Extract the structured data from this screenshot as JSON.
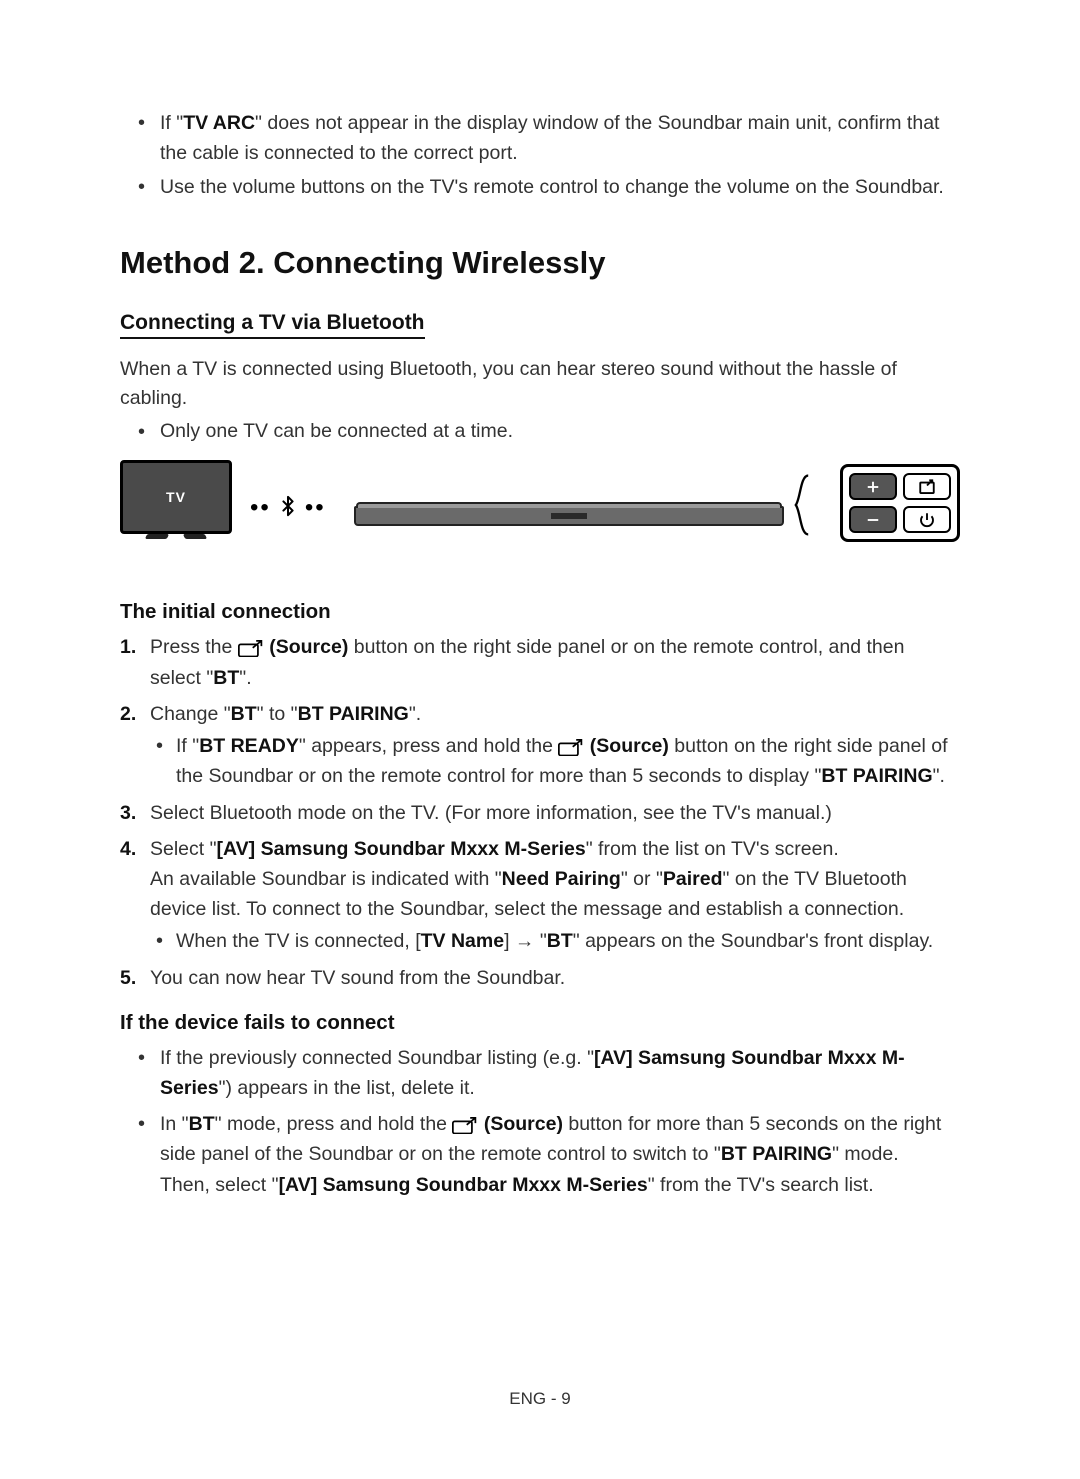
{
  "top_bullets": {
    "b1_pre": "If \"",
    "b1_bold": "TV ARC",
    "b1_post": "\" does not appear in the display window of the Soundbar main unit, confirm that the cable is connected to the correct port.",
    "b2": "Use the volume buttons on the TV's remote control to change the volume on the Soundbar."
  },
  "method_title": "Method 2. Connecting Wirelessly",
  "sub_title": "Connecting a TV via Bluetooth",
  "intro_text": "When a TV is connected using Bluetooth, you can hear stereo sound without the hassle of cabling.",
  "intro_bullet": "Only one TV can be connected at a time.",
  "diagram": {
    "tv_label": "TV"
  },
  "initial_heading": "The initial connection",
  "steps": {
    "s1_a": "Press the ",
    "s1_source": " (Source)",
    "s1_b": " button on the right side panel or on the remote control, and then select \"",
    "s1_bt": "BT",
    "s1_c": "\".",
    "s2_a": "Change \"",
    "s2_bt": "BT",
    "s2_b": "\" to \"",
    "s2_pair": "BT PAIRING",
    "s2_c": "\".",
    "s2_bullet_a": "If \"",
    "s2_bullet_btready": "BT READY",
    "s2_bullet_b": "\" appears, press and hold the ",
    "s2_bullet_source": " (Source)",
    "s2_bullet_c": " button on the right side panel of the Soundbar or on the remote control for more than 5 seconds to display \"",
    "s2_bullet_pair": "BT PAIRING",
    "s2_bullet_d": "\".",
    "s3": "Select Bluetooth mode on the TV. (For more information, see the TV's manual.)",
    "s4_a": "Select \"",
    "s4_av": "[AV] Samsung Soundbar Mxxx M-Series",
    "s4_b": "\" from the list on TV's screen.",
    "s4_c": "An available Soundbar is indicated with \"",
    "s4_need": "Need Pairing",
    "s4_d": "\" or \"",
    "s4_paired": "Paired",
    "s4_e": "\" on the TV Bluetooth device list. To connect to the Soundbar, select the message and establish a connection.",
    "s4_bullet_a": "When the TV is connected, [",
    "s4_bullet_tvname": "TV Name",
    "s4_bullet_b": "] → \"",
    "s4_bullet_bt": "BT",
    "s4_bullet_c": "\" appears on the Soundbar's front display.",
    "s5": "You can now hear TV sound from the Soundbar."
  },
  "fail_heading": "If the device fails to connect",
  "fail": {
    "f1_a": "If the previously connected Soundbar listing (e.g. \"",
    "f1_av": "[AV] Samsung Soundbar Mxxx M-Series",
    "f1_b": "\") appears in the list, delete it.",
    "f2_a": "In \"",
    "f2_bt": "BT",
    "f2_b": "\" mode, press and hold the ",
    "f2_source": " (Source)",
    "f2_c": " button for more than 5 seconds on the right side panel of the Soundbar or on the remote control to switch to \"",
    "f2_pair": "BT PAIRING",
    "f2_d": "\" mode.",
    "f2_e": "Then, select \"",
    "f2_av": "[AV] Samsung Soundbar Mxxx M-Series",
    "f2_f": "\" from the TV's search list."
  },
  "footer": "ENG - 9"
}
